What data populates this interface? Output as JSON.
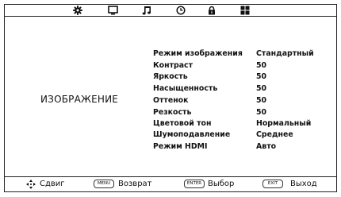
{
  "tabs": [
    {
      "icon": "gear-icon"
    },
    {
      "icon": "monitor-icon"
    },
    {
      "icon": "music-note-icon"
    },
    {
      "icon": "clock-icon"
    },
    {
      "icon": "lock-icon"
    },
    {
      "icon": "grid-icon"
    }
  ],
  "section": {
    "title": "ИЗОБРАЖЕНИЕ"
  },
  "settings": [
    {
      "label": "Режим изображения",
      "value": "Стандартный"
    },
    {
      "label": "Контраст",
      "value": "50"
    },
    {
      "label": "Яркость",
      "value": "50"
    },
    {
      "label": "Насыщенность",
      "value": "50"
    },
    {
      "label": "Оттенок",
      "value": "50"
    },
    {
      "label": "Резкость",
      "value": "50"
    },
    {
      "label": "Цветовой тон",
      "value": "Нормальный"
    },
    {
      "label": "Шумоподавление",
      "value": "Среднее"
    },
    {
      "label": "Режим HDMI",
      "value": "Авто"
    }
  ],
  "footer": {
    "move_label": "Сдвиг",
    "menu_key": "MENU",
    "back_label": "Возврат",
    "enter_key": "ENTER",
    "select_label": "Выбор",
    "exit_key": "EXIT",
    "exit_label": "Выход"
  },
  "colors": {
    "background": "#ffffff",
    "foreground": "#111111",
    "border": "#222222"
  }
}
